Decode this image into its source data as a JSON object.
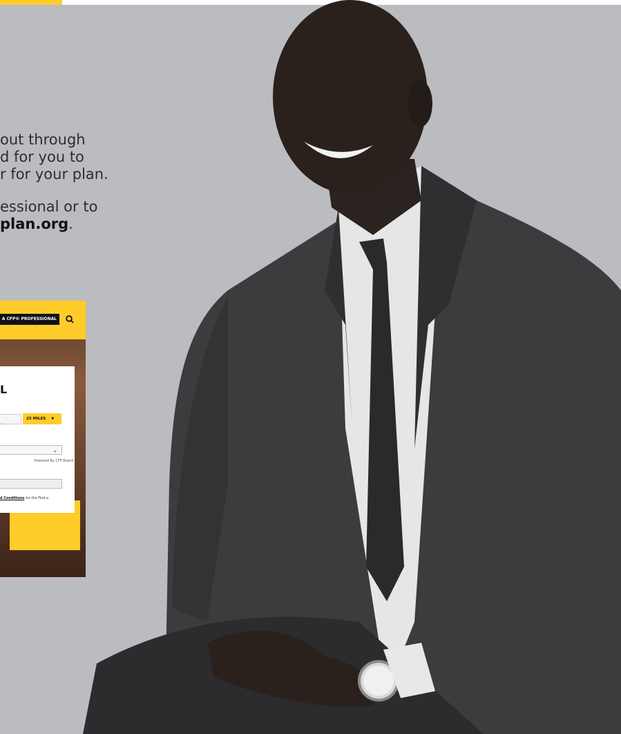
{
  "brochure": {
    "paragraph1": [
      "out through",
      "d for you to",
      "r for your plan."
    ],
    "paragraph2_line1": "essional or to",
    "paragraph2_bold": "plan.org",
    "paragraph2_end": "."
  },
  "embedded_screenshot": {
    "nav_button_label": "A CFP® PROFESSIONAL",
    "heading_fragment": "L",
    "radius_label": "25 MILES",
    "zip_value": "r",
    "terms_link": "d Conditions",
    "terms_text": " for the Find a",
    "powered_by": "Powered By CFP Board"
  },
  "colors": {
    "background": "#bbbcc0",
    "accent_yellow": "#ffcc29",
    "text": "#2d2d2d"
  }
}
